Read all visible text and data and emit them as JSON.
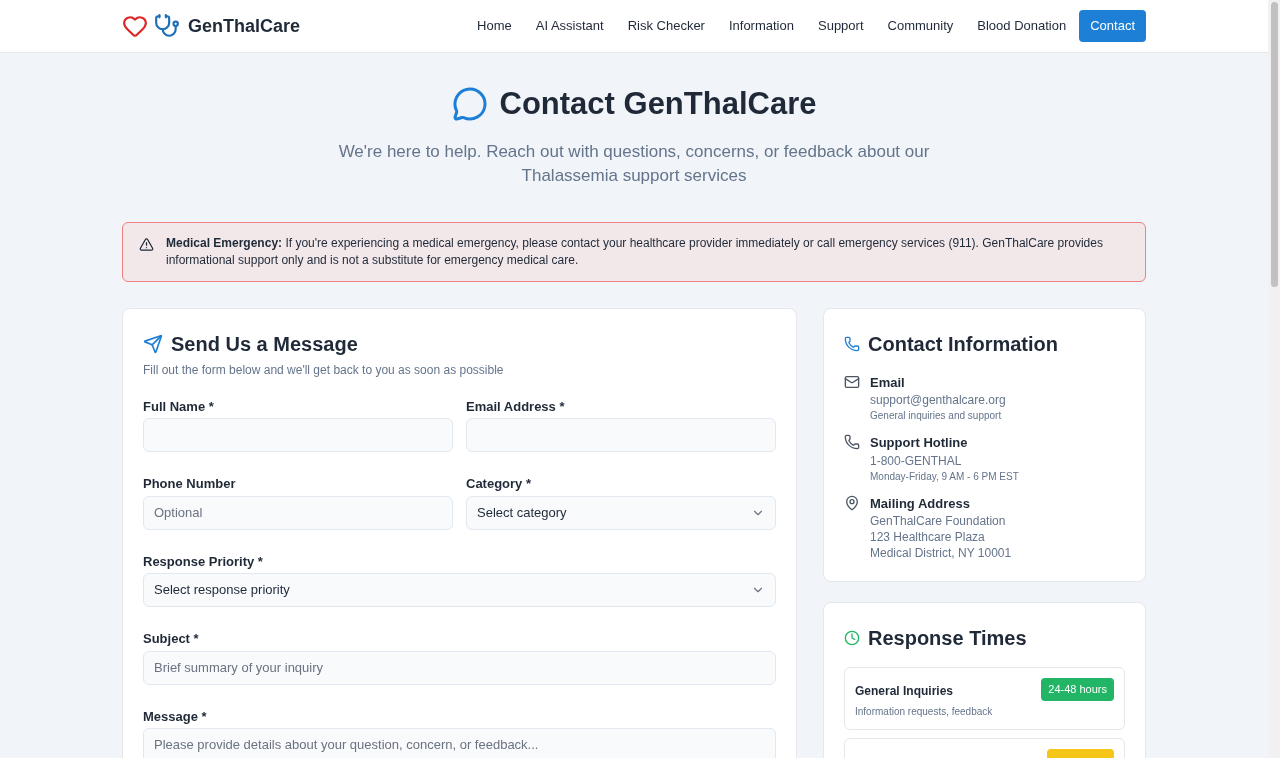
{
  "brand": {
    "name": "GenThalCare"
  },
  "nav": [
    {
      "label": "Home",
      "selected": false
    },
    {
      "label": "AI Assistant",
      "selected": false
    },
    {
      "label": "Risk Checker",
      "selected": false
    },
    {
      "label": "Information",
      "selected": false
    },
    {
      "label": "Support",
      "selected": false
    },
    {
      "label": "Community",
      "selected": false
    },
    {
      "label": "Blood Donation",
      "selected": false
    },
    {
      "label": "Contact",
      "selected": true
    }
  ],
  "hero": {
    "title": "Contact GenThalCare",
    "subtitle": "We're here to help. Reach out with questions, concerns, or feedback about our Thalassemia support services"
  },
  "alert": {
    "text": "**Medical Emergency:** If you're experiencing a medical emergency, please contact your healthcare provider immediately or call emergency services (911). GenThalCare provides informational support only and is not a substitute for emergency medical care."
  },
  "form": {
    "title": "Send Us a Message",
    "subtitle": "Fill out the form below and we'll get back to you as soon as possible",
    "rows": [
      [
        {
          "label": "Full Name *",
          "kind": "input"
        },
        {
          "label": "Email Address *",
          "kind": "input"
        }
      ],
      [
        {
          "label": "Phone Number",
          "kind": "input",
          "placeholder": "Optional"
        },
        {
          "label": "Category *",
          "kind": "select",
          "value": "Select category"
        }
      ],
      [
        {
          "label": "Response Priority *",
          "kind": "select",
          "value": "Select response priority"
        }
      ],
      [
        {
          "label": "Subject *",
          "kind": "input",
          "placeholder": "Brief summary of your inquiry"
        }
      ],
      [
        {
          "label": "Message *",
          "kind": "textarea",
          "placeholder": "Please provide details about your question, concern, or feedback..."
        }
      ]
    ]
  },
  "contact_info": {
    "title": "Contact Information",
    "items": [
      {
        "kind": "email",
        "title": "Email",
        "lines": [
          "support@genthalcare.org"
        ],
        "note": "General inquiries and support"
      },
      {
        "kind": "phone",
        "title": "Support Hotline",
        "lines": [
          "1-800-GENTHAL"
        ],
        "note": "Monday-Friday, 9 AM - 6 PM EST"
      },
      {
        "kind": "address",
        "title": "Mailing Address",
        "lines": [
          "GenThalCare Foundation",
          "123 Healthcare Plaza",
          "Medical District, NY 10001"
        ]
      }
    ]
  },
  "response_times": {
    "title": "Response Times",
    "items": [
      {
        "title": "General Inquiries",
        "description": "Information requests, feedback",
        "badge": "24-48 hours",
        "color": "#22b566"
      },
      {
        "color": "#f5c518"
      }
    ]
  }
}
